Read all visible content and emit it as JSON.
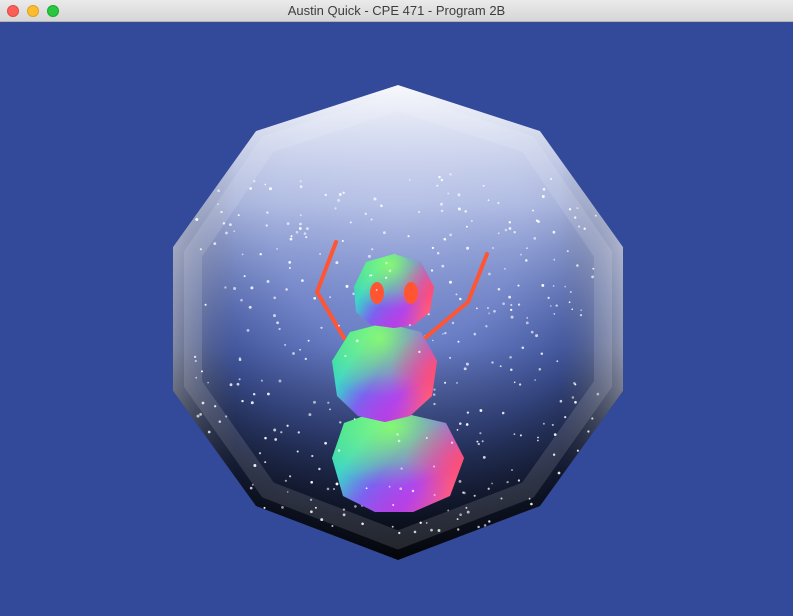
{
  "window": {
    "title": "Austin Quick - CPE 471 - Program 2B"
  },
  "titlebar": {
    "buttons": [
      {
        "name": "close",
        "color": "#fc5f57"
      },
      {
        "name": "minimize",
        "color": "#fdbc2e"
      },
      {
        "name": "zoom",
        "color": "#28c840"
      }
    ]
  },
  "scene": {
    "background_color": "#33499a",
    "globe_shape": "decagon",
    "subject": "snowman",
    "snow_particles": 420
  }
}
